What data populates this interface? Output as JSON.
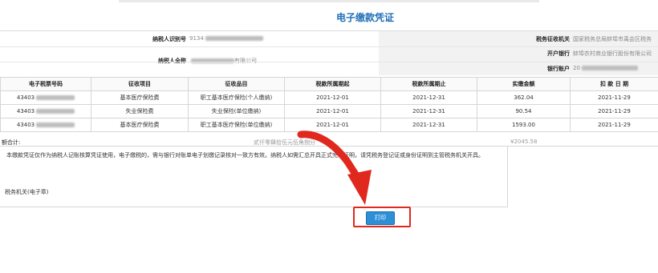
{
  "title": "电子缴款凭证",
  "header": {
    "taxpayer_id_label": "纳税人识别号",
    "taxpayer_id_value": "9134",
    "tax_authority_label": "税务征收机关",
    "tax_authority_value": "国家税务总局蚌埠市禹会区税务",
    "bank_label": "开户银行",
    "bank_value": "蚌埠农村商业银行股份有限公司",
    "taxpayer_name_label": "纳税人全称",
    "taxpayer_name_value": "有限公司",
    "account_label": "银行账户",
    "account_value": "20"
  },
  "table": {
    "columns": [
      "电子税票号码",
      "征收项目",
      "征收品目",
      "税款所属期起",
      "税款所属期止",
      "实缴金额",
      "扣 款 日 期"
    ],
    "rows": [
      [
        "43403",
        "基本医疗保险费",
        "职工基本医疗保险(个人缴纳)",
        "2021-12-01",
        "2021-12-31",
        "362.04",
        "2021-11-29"
      ],
      [
        "43403",
        "失业保险费",
        "失业保险(单位缴纳)",
        "2021-12-01",
        "2021-12-31",
        "90.54",
        "2021-11-29"
      ],
      [
        "43403",
        "基本医疗保险费",
        "职工基本医疗保险(单位缴纳)",
        "2021-12-01",
        "2021-12-31",
        "1593.00",
        "2021-11-29"
      ]
    ]
  },
  "summary": {
    "label": "额合计:",
    "amount_words": "贰仟零肆拾伍元伍角捌分",
    "amount": "¥2045.58"
  },
  "notes": {
    "text": "本缴款凭证仅作为纳税人记账核算凭证使用，电子缴税的，需与银行对账单电子划缴记录核对一致方有效。纳税人如需汇总开具正式完税证明，请凭税务登记证或身份证明到主管税务机关开具。",
    "stamp_label": "税务机关(电子章)"
  },
  "print_button": "打印",
  "colors": {
    "accent": "#1f6fb8",
    "button": "#2d8fd6",
    "highlight": "#e0281f"
  }
}
